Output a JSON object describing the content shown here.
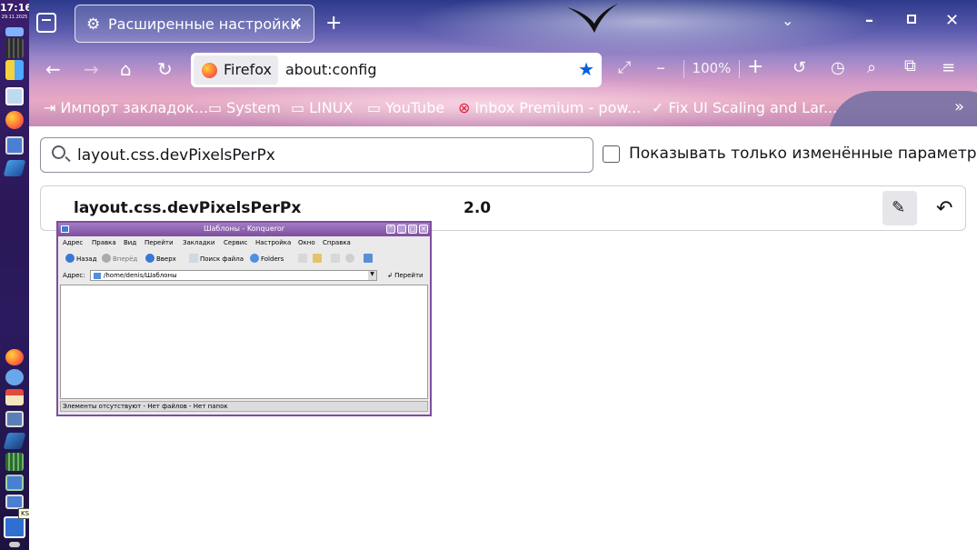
{
  "taskbar": {
    "time": "17:16",
    "date": "29.11.2025",
    "tooltip": "KSnapshot"
  },
  "tabs": {
    "active_title": "Расширенные настройки",
    "new_tab": "+",
    "close": "✕"
  },
  "window_controls": {
    "tabs_menu": "⌄",
    "minimize": "–",
    "close": "✕"
  },
  "urlbar": {
    "identity_label": "Firefox",
    "url": "about:config"
  },
  "toolbar": {
    "zoom_level": "100%"
  },
  "bookmarks": [
    {
      "label": "Импорт закладок...",
      "icon": "import-icon"
    },
    {
      "label": "System",
      "icon": "folder-icon"
    },
    {
      "label": "LINUX",
      "icon": "folder-icon"
    },
    {
      "label": "YouTube",
      "icon": "folder-icon"
    },
    {
      "label": "Inbox Premium - pow...",
      "icon": "mail-icon"
    },
    {
      "label": "Fix UI Scaling and Lar...",
      "icon": "page-icon"
    }
  ],
  "config": {
    "search_value": "layout.css.devPixelsPerPx",
    "only_modified_label": "Показывать только изменённые параметры",
    "only_modified_checked": false,
    "pref_name": "layout.css.devPixelsPerPx",
    "pref_value": "2.0"
  },
  "konqueror": {
    "title": "Шаблоны - Konqueror",
    "menus": [
      "Адрес",
      "Правка",
      "Вид",
      "Перейти",
      "Закладки",
      "Сервис",
      "Настройка",
      "Окно",
      "Справка"
    ],
    "toolbar": {
      "back": "Назад",
      "forward": "Вперёд",
      "up": "Вверх",
      "find": "Поиск файла",
      "folders": "Folders"
    },
    "address_label": "Адрес:",
    "address_value": "/home/denis/Шаблоны",
    "go_label": "Перейти",
    "status": "Элементы отсутствуют - Нет файлов - Нет папок"
  },
  "colors": {
    "accent_star": "#0060df",
    "konqueror_frame": "#7d4e9e"
  }
}
